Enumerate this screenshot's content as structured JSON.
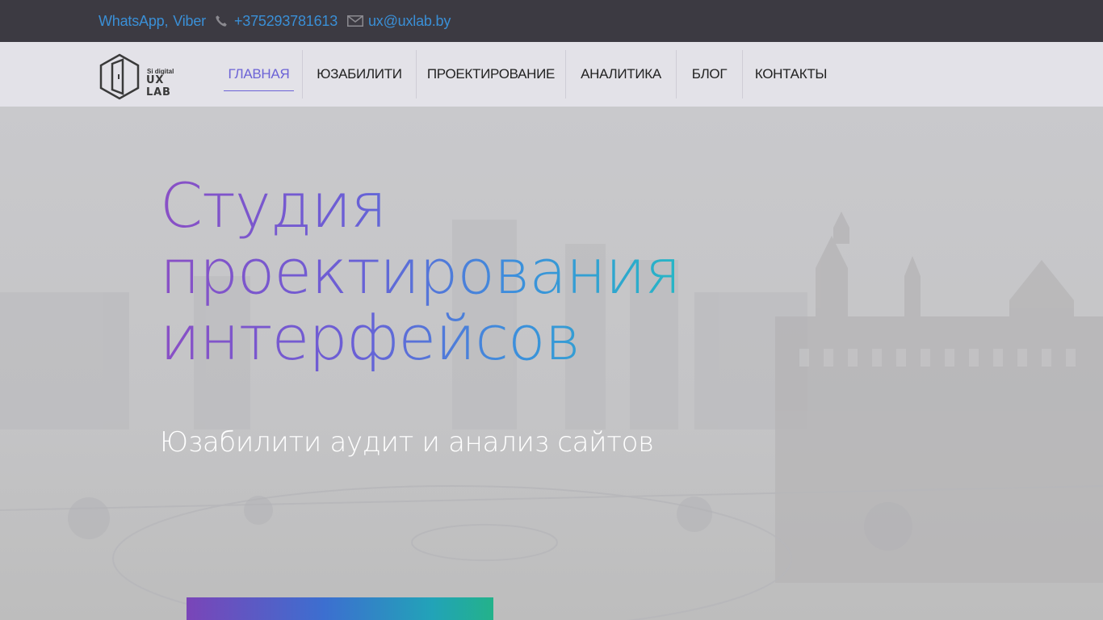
{
  "topbar": {
    "messengers_whatsapp": "WhatsApp",
    "messengers_sep": ",",
    "messengers_viber": "Viber",
    "phone": "+375293781613",
    "email": "ux@uxlab.by"
  },
  "logo": {
    "small": "Si digital",
    "big": "UX LAB"
  },
  "nav": {
    "items": [
      {
        "label": "ГЛАВНАЯ",
        "active": true
      },
      {
        "label": "ЮЗАБИЛИТИ"
      },
      {
        "label": "ПРОЕКТИРОВАНИЕ"
      },
      {
        "label": "АНАЛИТИКА"
      },
      {
        "label": "БЛОГ"
      },
      {
        "label": "КОНТАКТЫ"
      }
    ]
  },
  "hero": {
    "title_line1": "Студия",
    "title_line2": "проектирования",
    "title_line3": "интерфейсов",
    "subtitle": "Юзабилити аудит и анализ сайтов"
  },
  "colors": {
    "topbar_bg": "#3c3a42",
    "link": "#3a8fd6",
    "nav_bg": "#e3e2e8",
    "active_nav": "#6c63d6",
    "gradient_start": "#8a4fc5",
    "gradient_end": "#26b7b0"
  }
}
